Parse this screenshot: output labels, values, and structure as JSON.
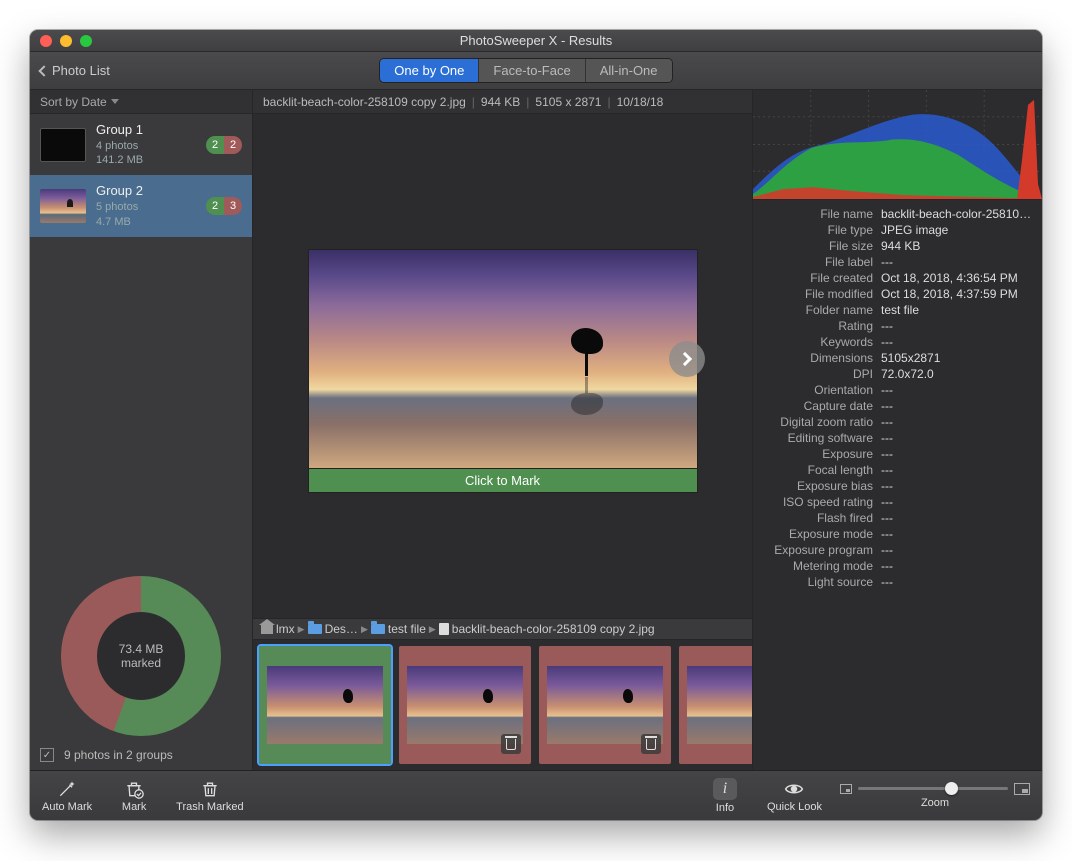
{
  "window": {
    "title": "PhotoSweeper X - Results"
  },
  "toolbar": {
    "back_label": "Photo List",
    "segments": [
      "One by One",
      "Face-to-Face",
      "All-in-One"
    ],
    "active_segment": 0
  },
  "sidebar": {
    "sort_label": "Sort by Date",
    "groups": [
      {
        "name": "Group 1",
        "count_label": "4 photos",
        "size_label": "141.2 MB",
        "badge_keep": "2",
        "badge_mark": "2",
        "selected": false,
        "thumb": "black"
      },
      {
        "name": "Group 2",
        "count_label": "5 photos",
        "size_label": "4.7 MB",
        "badge_keep": "2",
        "badge_mark": "3",
        "selected": true,
        "thumb": "sunset"
      }
    ],
    "donut": {
      "line1": "73.4 MB",
      "line2": "marked"
    },
    "footer_text": "9 photos in 2 groups"
  },
  "info_strip": {
    "filename": "backlit-beach-color-258109 copy 2.jpg",
    "filesize": "944 KB",
    "dimensions": "5105 x 2871",
    "date": "10/18/18"
  },
  "preview": {
    "mark_label": "Click to Mark"
  },
  "breadcrumb": {
    "segments": [
      "lmx",
      "Des…",
      "test file",
      "backlit-beach-color-258109 copy 2.jpg"
    ]
  },
  "filmstrip": [
    {
      "color": "green",
      "selected": true,
      "trash": false
    },
    {
      "color": "red",
      "selected": false,
      "trash": true
    },
    {
      "color": "red",
      "selected": false,
      "trash": true
    },
    {
      "color": "red",
      "selected": false,
      "trash": true
    },
    {
      "color": "green",
      "selected": false,
      "trash": false
    }
  ],
  "metadata": [
    {
      "label": "File name",
      "value": "backlit-beach-color-258109…"
    },
    {
      "label": "File type",
      "value": "JPEG image"
    },
    {
      "label": "File size",
      "value": "944 KB"
    },
    {
      "label": "File label",
      "value": "---"
    },
    {
      "label": "File created",
      "value": "Oct 18, 2018, 4:36:54 PM"
    },
    {
      "label": "File modified",
      "value": "Oct 18, 2018, 4:37:59 PM"
    },
    {
      "label": "Folder name",
      "value": "test file"
    },
    {
      "label": "Rating",
      "value": "---"
    },
    {
      "label": "Keywords",
      "value": "---"
    },
    {
      "label": "Dimensions",
      "value": "5105x2871"
    },
    {
      "label": "DPI",
      "value": "72.0x72.0"
    },
    {
      "label": "Orientation",
      "value": "---"
    },
    {
      "label": "Capture date",
      "value": "---"
    },
    {
      "label": "Digital zoom ratio",
      "value": "---"
    },
    {
      "label": "Editing software",
      "value": "---"
    },
    {
      "label": "Exposure",
      "value": "---"
    },
    {
      "label": "Focal length",
      "value": "---"
    },
    {
      "label": "Exposure bias",
      "value": "---"
    },
    {
      "label": "ISO speed rating",
      "value": "---"
    },
    {
      "label": "Flash fired",
      "value": "---"
    },
    {
      "label": "Exposure mode",
      "value": "---"
    },
    {
      "label": "Exposure program",
      "value": "---"
    },
    {
      "label": "Metering mode",
      "value": "---"
    },
    {
      "label": "Light source",
      "value": "---"
    }
  ],
  "bottombar": {
    "auto_mark": "Auto Mark",
    "mark": "Mark",
    "trash_marked": "Trash Marked",
    "info": "Info",
    "quick_look": "Quick Look",
    "zoom": "Zoom"
  }
}
